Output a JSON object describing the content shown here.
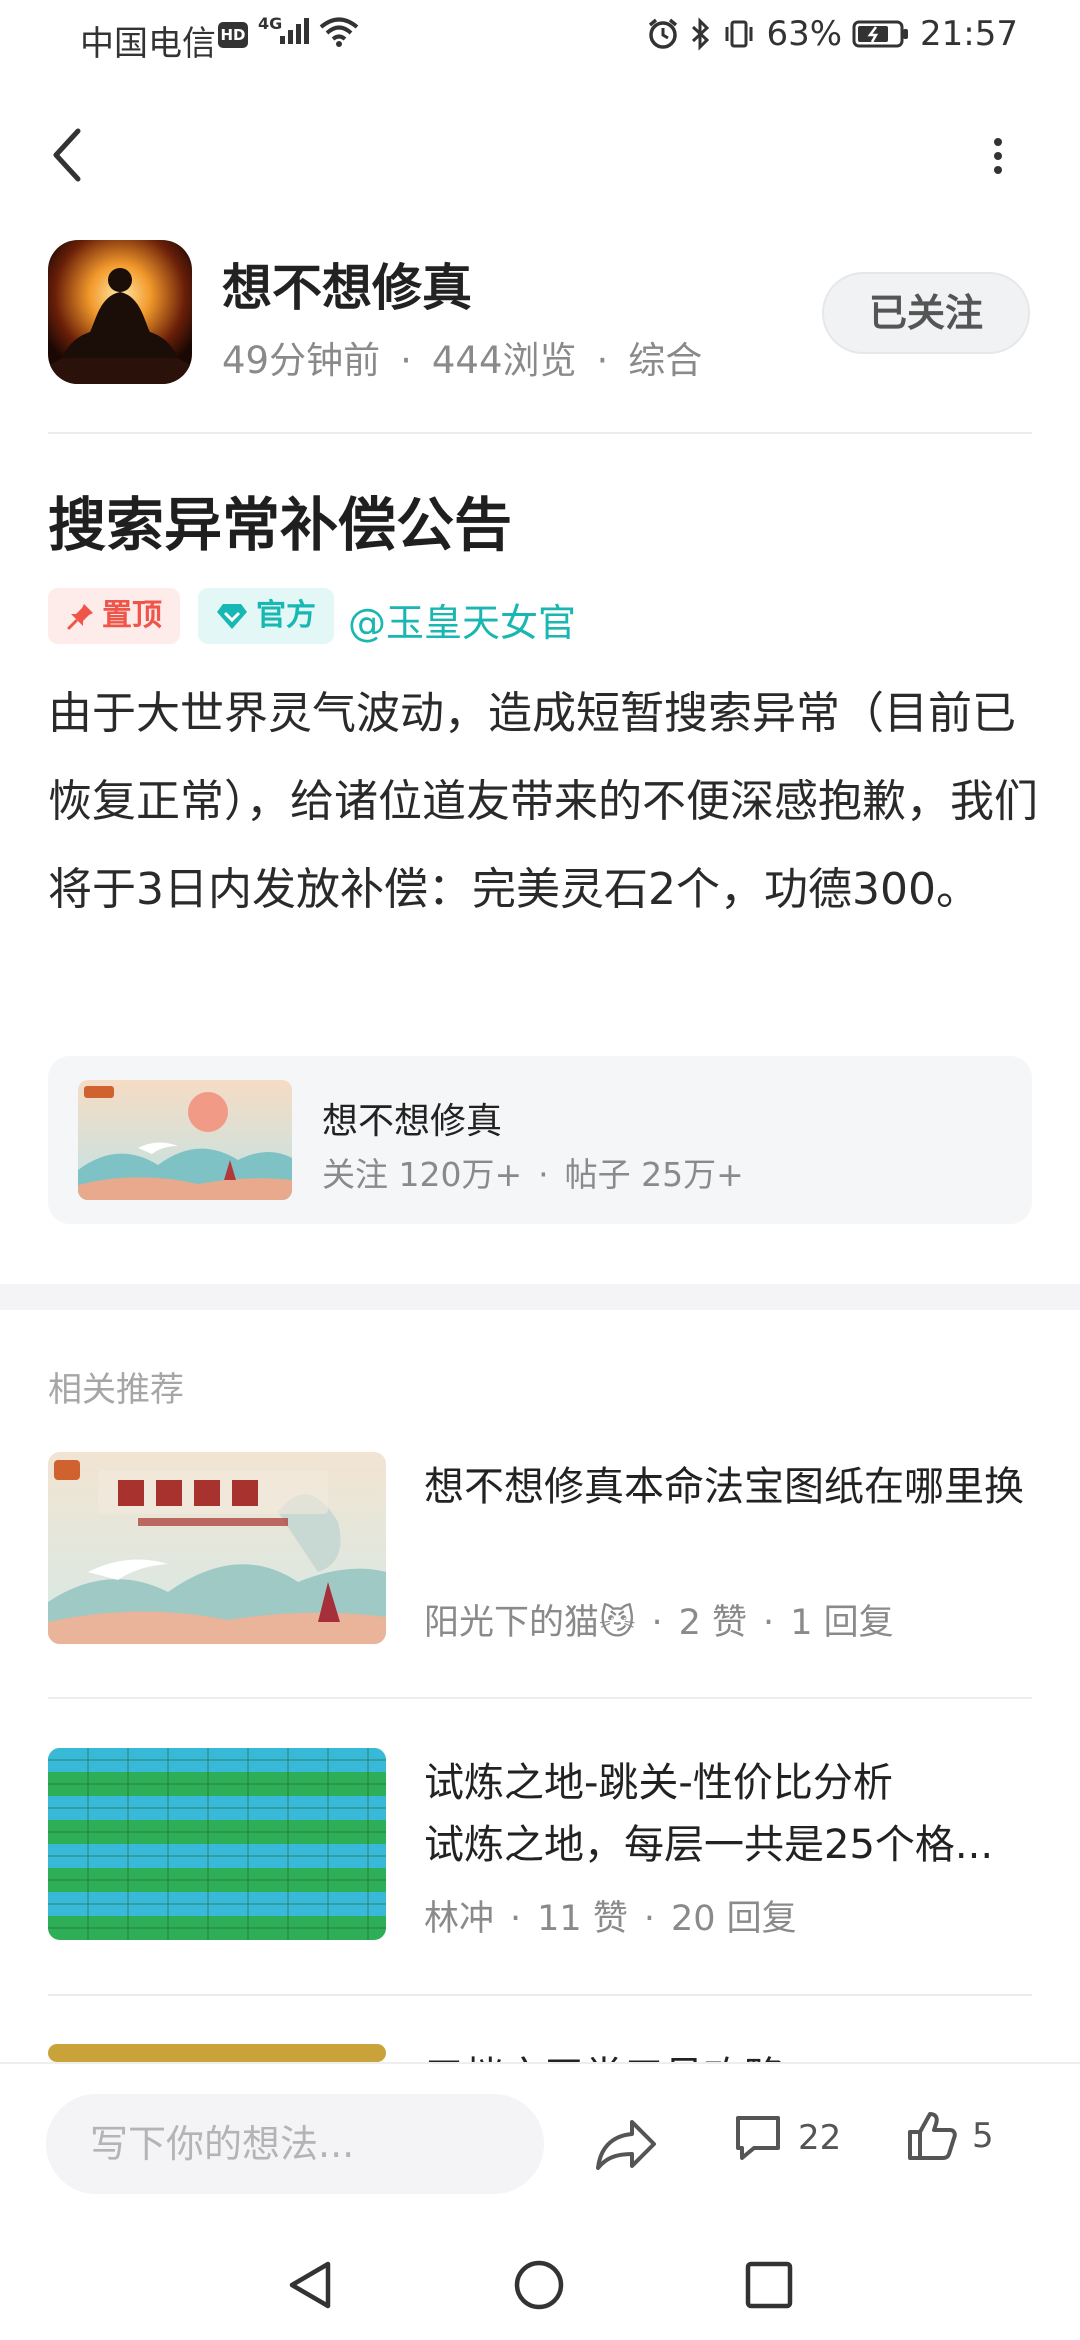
{
  "status_bar": {
    "carrier": "中国电信",
    "hd_badge": "HD",
    "network": "4G",
    "battery": "63%",
    "time": "21:57"
  },
  "post": {
    "author": "想不想修真",
    "time_ago": "49分钟前",
    "views": "444浏览",
    "category": "综合",
    "follow_label": "已关注",
    "title": "搜索异常补偿公告",
    "tag_pinned": "置顶",
    "tag_official": "官方",
    "mention": "@玉皇天女官",
    "content": "由于大世界灵气波动，造成短暂搜索异常（目前已恢复正常），给诸位道友带来的不便深感抱歉，我们将于3日内发放补偿：完美灵石2个，功德300。"
  },
  "forum": {
    "name": "想不想修真",
    "followers": "关注 120万+",
    "posts": "帖子 25万+"
  },
  "related": {
    "label": "相关推荐",
    "items": [
      {
        "title": "想不想修真本命法宝图纸在哪里换",
        "author": "阳光下的猫😼",
        "likes": "2 赞",
        "replies": "1 回复"
      },
      {
        "title": "试炼之地-跳关-性价比分析",
        "subtitle": "试炼之地，每层一共是25个格...",
        "author": "林冲",
        "likes": "11 赞",
        "replies": "20 回复"
      },
      {
        "title": "三档充天堂三号攻略"
      }
    ]
  },
  "bottom_bar": {
    "input_placeholder": "写下你的想法...",
    "comment_count": "22",
    "like_count": "5"
  },
  "colors": {
    "accent": "#19b6b2",
    "pinned": "#f0554a",
    "muted": "#8a8a8a"
  }
}
